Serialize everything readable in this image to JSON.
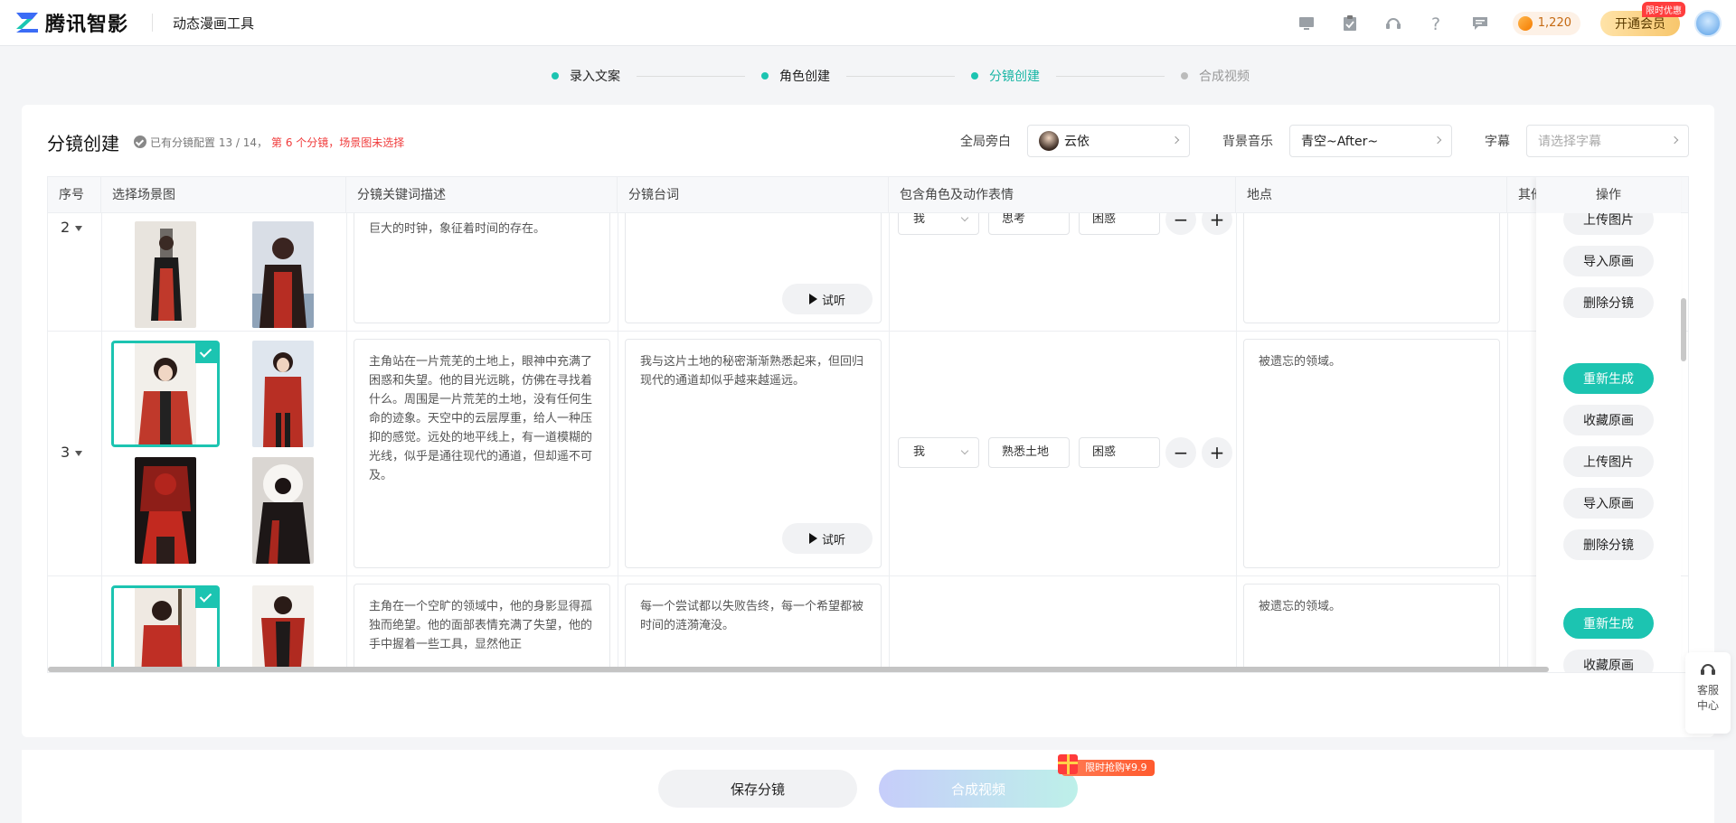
{
  "header": {
    "brand": "腾讯智影",
    "app_name": "动态漫画工具",
    "coins": "1,220",
    "vip_label": "开通会员",
    "vip_badge": "限时优惠",
    "icons": [
      "monitor-icon",
      "clipboard-icon",
      "headset-icon",
      "help-icon",
      "message-icon"
    ]
  },
  "steps": [
    {
      "label": "录入文案",
      "state": "done"
    },
    {
      "label": "角色创建",
      "state": "done"
    },
    {
      "label": "分镜创建",
      "state": "active"
    },
    {
      "label": "合成视频",
      "state": "todo"
    }
  ],
  "page": {
    "title": "分镜创建",
    "config_text": "已有分镜配置 13 / 14，",
    "config_warning": "第 6 个分镜，场景图未选择",
    "narrator_label": "全局旁白",
    "narrator_value": "云依",
    "bgm_label": "背景音乐",
    "bgm_value": "青空~After~",
    "subtitle_label": "字幕",
    "subtitle_placeholder": "请选择字幕"
  },
  "table": {
    "columns": [
      "序号",
      "选择场景图",
      "分镜关键词描述",
      "分镜台词",
      "包含角色及动作表情",
      "地点",
      "其他",
      "操作"
    ],
    "rows": [
      {
        "seq": "2",
        "description": "巨大的时钟，象征着时间的存在。",
        "dialogue": "",
        "role": "我",
        "action": "思考",
        "expression": "困惑",
        "location": "",
        "listen_label": "试听",
        "ops": [
          "上传图片",
          "导入原画",
          "删除分镜"
        ]
      },
      {
        "seq": "3",
        "description": "主角站在一片荒芜的土地上，眼神中充满了困惑和失望。他的目光远眺，仿佛在寻找着什么。周围是一片荒芜的土地，没有任何生命的迹象。天空中的云层厚重，给人一种压抑的感觉。远处的地平线上，有一道模糊的光线，似乎是通往现代的通道，但却遥不可及。",
        "dialogue": "我与这片土地的秘密渐渐熟悉起来，但回归现代的通道却似乎越来越遥远。",
        "role": "我",
        "action": "熟悉土地",
        "expression": "困惑",
        "location": "被遗忘的领域。",
        "listen_label": "试听",
        "ops": [
          "重新生成",
          "收藏原画",
          "上传图片",
          "导入原画",
          "删除分镜"
        ]
      },
      {
        "seq": "",
        "description": "主角在一个空旷的领域中，他的身影显得孤独而绝望。他的面部表情充满了失望，他的手中握着一些工具，显然他正",
        "dialogue": "每一个尝试都以失败告终，每一个希望都被时间的涟漪淹没。",
        "location": "被遗忘的领域。",
        "ops": [
          "重新生成",
          "收藏原画"
        ]
      }
    ]
  },
  "bottom": {
    "save_label": "保存分镜",
    "compose_label": "合成视频",
    "promo_label": "限时抢购¥9.9"
  },
  "service": {
    "label": "客服中心"
  },
  "colors": {
    "accent": "#1cc4b1",
    "warning": "#f03a3a",
    "vip": "#f7c66c"
  }
}
